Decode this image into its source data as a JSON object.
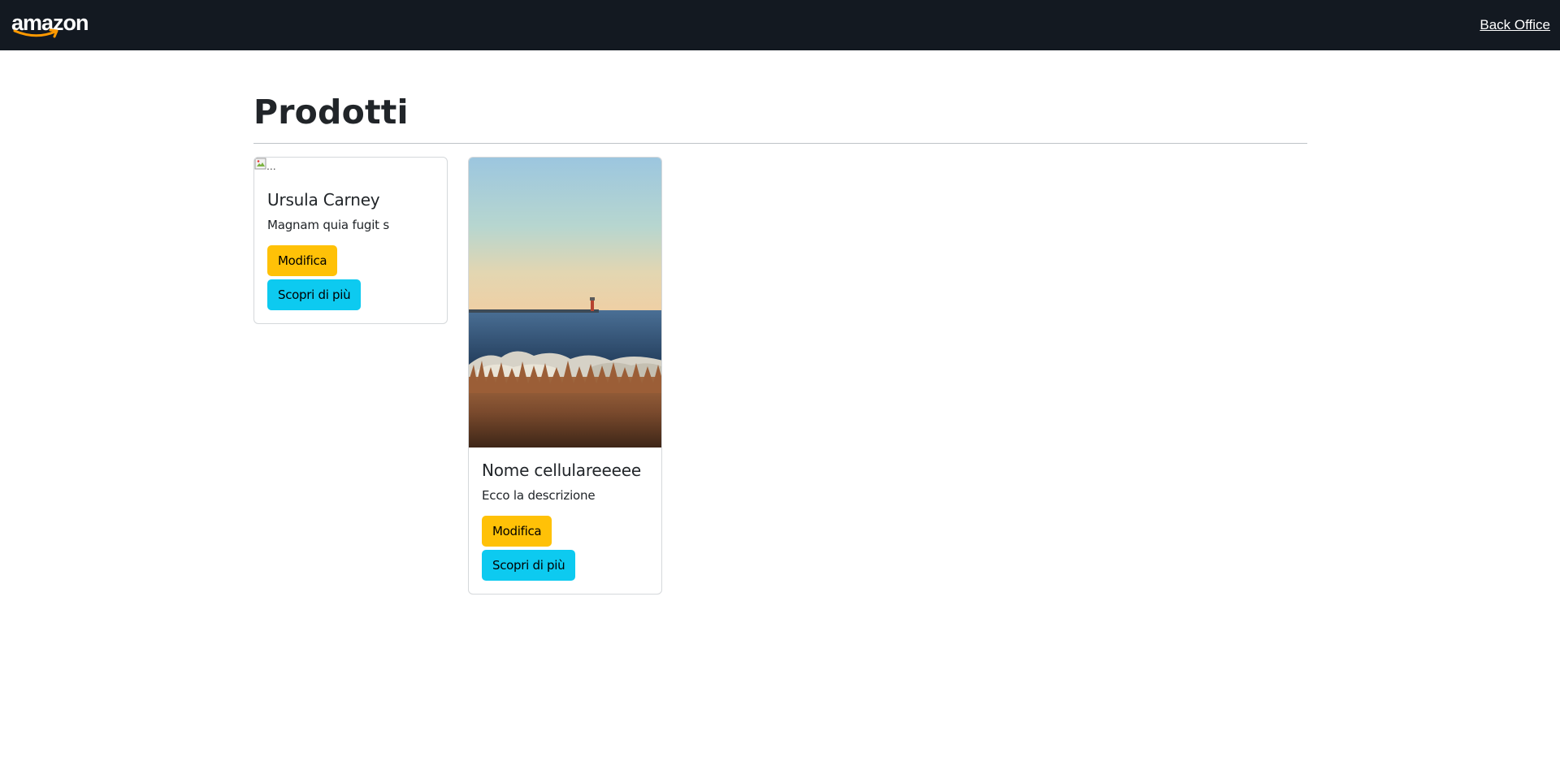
{
  "navbar": {
    "logo_text": "amazon",
    "link_label": "Back Office"
  },
  "page": {
    "title": "Prodotti"
  },
  "products": [
    {
      "title": "Ursula Carney",
      "description": "Magnam quia fugit s",
      "image_alt": "...",
      "image": "broken-image-icon",
      "edit_label": "Modifica",
      "more_label": "Scopri di più"
    },
    {
      "title": "Nome cellulareeeee",
      "description": "Ecco la descrizione",
      "image": "lighthouse-seascape-photo",
      "edit_label": "Modifica",
      "more_label": "Scopri di più"
    }
  ],
  "colors": {
    "navbar": "#131921",
    "warning": "#ffc107",
    "info": "#0dcaf0",
    "logo_smile": "#ff9900"
  }
}
